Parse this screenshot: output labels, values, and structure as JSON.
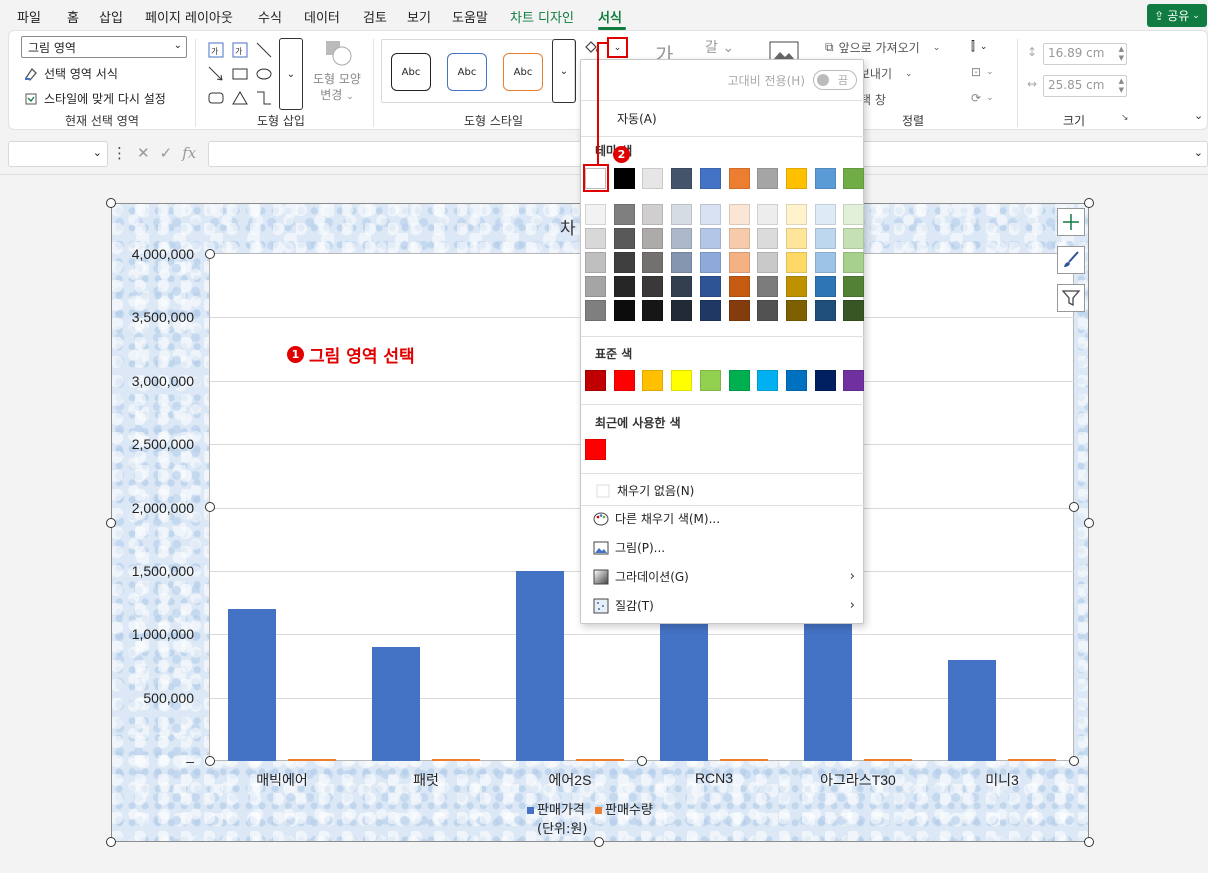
{
  "menu": {
    "tabs": [
      "파일",
      "홈",
      "삽입",
      "페이지 레이아웃",
      "수식",
      "데이터",
      "검토",
      "보기",
      "도움말",
      "차트 디자인",
      "서식"
    ],
    "share_label": "공유"
  },
  "ribbon": {
    "current_selection": {
      "dropdown_value": "그림 영역",
      "format_selection": "선택 영역 서식",
      "reset_style": "스타일에 맞게 다시 설정",
      "group_label": "현재 선택 영역"
    },
    "insert_shapes": {
      "group_label": "도형 삽입",
      "change_shape_line1": "도형 모양",
      "change_shape_line2": "변경"
    },
    "shape_styles": {
      "samples": [
        "Abc",
        "Abc",
        "Abc"
      ],
      "group_label": "도형 스타일"
    },
    "arrange": {
      "bring_forward": "앞으로 가져오기",
      "send_backward": "뒤로 보내기",
      "selection_pane": "선택 창",
      "group_label": "정렬"
    },
    "size": {
      "height": "16.89 cm",
      "width": "25.85 cm",
      "group_label": "크기"
    }
  },
  "palette": {
    "high_contrast_label": "고대비 전용(H)",
    "toggle_state": "끔",
    "automatic": "자동(A)",
    "theme_colors_header": "테마 색",
    "theme_colors": [
      "#FFFFFF",
      "#000000",
      "#E7E6E6",
      "#44546A",
      "#4472C4",
      "#ED7D31",
      "#A5A5A5",
      "#FFC000",
      "#5B9BD5",
      "#70AD47"
    ],
    "theme_shades": [
      [
        "#F2F2F2",
        "#7F7F7F",
        "#D0CECE",
        "#D6DCE4",
        "#D9E2F3",
        "#FBE5D5",
        "#EDEDED",
        "#FFF2CC",
        "#DEEBF6",
        "#E2EFD9"
      ],
      [
        "#D8D8D8",
        "#595959",
        "#AEAAAA",
        "#ADB9CA",
        "#B4C6E7",
        "#F7CAAC",
        "#DBDBDB",
        "#FFE599",
        "#BDD7EE",
        "#C5E0B3"
      ],
      [
        "#BFBFBF",
        "#3F3F3F",
        "#757070",
        "#8496B0",
        "#8EAADB",
        "#F4B183",
        "#C9C9C9",
        "#FFD965",
        "#9DC3E6",
        "#A8D08D"
      ],
      [
        "#A5A5A5",
        "#262626",
        "#3A3838",
        "#323F4F",
        "#2F5496",
        "#C55A11",
        "#7B7B7B",
        "#BF9000",
        "#2E75B5",
        "#538135"
      ],
      [
        "#7F7F7F",
        "#0C0C0C",
        "#171616",
        "#222A35",
        "#1F3864",
        "#833C0B",
        "#525252",
        "#7F6000",
        "#1E4E79",
        "#375623"
      ]
    ],
    "standard_colors_header": "표준 색",
    "standard_colors": [
      "#C00000",
      "#FF0000",
      "#FFC000",
      "#FFFF00",
      "#92D050",
      "#00B050",
      "#00B0F0",
      "#0070C0",
      "#002060",
      "#7030A0"
    ],
    "recent_colors_header": "최근에 사용한 색",
    "recent_colors": [
      "#FF0000"
    ],
    "no_fill": "채우기 없음(N)",
    "more_colors": "다른 채우기 색(M)...",
    "picture": "그림(P)...",
    "gradient": "그라데이션(G)",
    "texture": "질감(T)"
  },
  "annotations": {
    "step1_badge": "1",
    "step1_text": "그림 영역 선택",
    "step2_badge": "2"
  },
  "chart_data": {
    "type": "bar",
    "title": "차",
    "categories": [
      "매빅에어",
      "패럿",
      "에어2S",
      "RCN3",
      "아그라스T30",
      "미니3"
    ],
    "series": [
      {
        "name": "판매가격",
        "values": [
          1200000,
          900000,
          1500000,
          1500000,
          1500000,
          800000
        ],
        "color": "#4472C4"
      },
      {
        "name": "판매수량",
        "values": [
          10,
          10,
          10,
          10,
          10,
          10
        ],
        "color": "#ED7D31"
      }
    ],
    "ylim": [
      0,
      4000000
    ],
    "yticks": [
      "4,000,000",
      "3,500,000",
      "3,000,000",
      "2,500,000",
      "2,000,000",
      "1,500,000",
      "1,000,000",
      "500,000",
      "–"
    ],
    "unit_label": "(단위:원)",
    "legend_position": "bottom",
    "grid": true
  }
}
